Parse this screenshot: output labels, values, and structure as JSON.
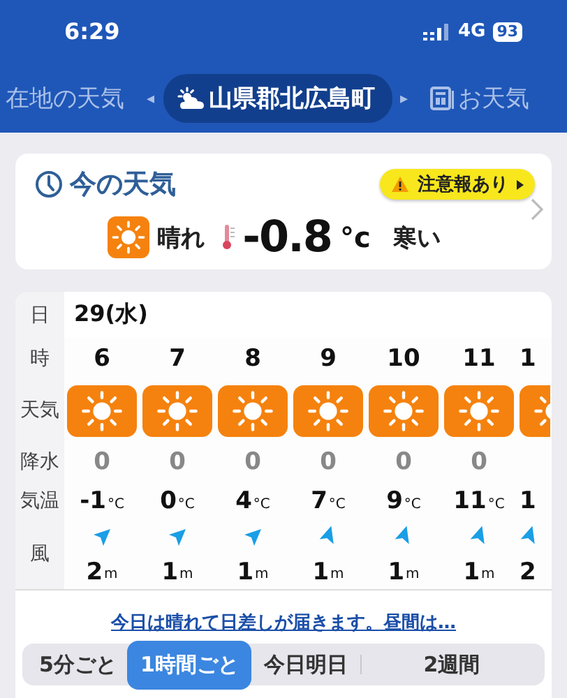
{
  "status_bar": {
    "time": "6:29",
    "network": "4G",
    "battery": "93"
  },
  "location_tabs": [
    {
      "label": "在地の天気",
      "selected": false,
      "kind": "plain"
    },
    {
      "label": "山県郡北広島町",
      "selected": true,
      "kind": "weather"
    },
    {
      "label": "お天気",
      "selected": false,
      "kind": "news"
    }
  ],
  "prev_arrow": "◂",
  "next_arrow": "▸",
  "now": {
    "title": "今の天気",
    "alert": "注意報あり",
    "condition": "晴れ",
    "temperature": "-0.8",
    "unit": "°c",
    "feel": "寒い"
  },
  "hourly": {
    "labels": [
      "日",
      "時",
      "天気",
      "降水",
      "気温",
      "風"
    ],
    "date": "29(水)",
    "columns": [
      {
        "hour": "6",
        "precip": "0",
        "temp": "-1",
        "temp_unit": "°C",
        "kind": "sw",
        "wind": "2",
        "wind_unit": "m"
      },
      {
        "hour": "7",
        "precip": "0",
        "temp": "0",
        "temp_unit": "°C",
        "kind": "sw",
        "wind": "1",
        "wind_unit": "m"
      },
      {
        "hour": "8",
        "precip": "0",
        "temp": "4",
        "temp_unit": "°C",
        "kind": "sw",
        "wind": "1",
        "wind_unit": "m"
      },
      {
        "hour": "9",
        "precip": "0",
        "temp": "7",
        "temp_unit": "°C",
        "kind": "wsw",
        "wind": "1",
        "wind_unit": "m"
      },
      {
        "hour": "10",
        "precip": "0",
        "temp": "9",
        "temp_unit": "°C",
        "kind": "wsw",
        "wind": "1",
        "wind_unit": "m"
      },
      {
        "hour": "11",
        "precip": "0",
        "temp": "11",
        "temp_unit": "°C",
        "kind": "wsw",
        "wind": "1",
        "wind_unit": "m"
      },
      {
        "hour": "1",
        "temp": "1",
        "kind": "wsw",
        "wind": "2"
      }
    ]
  },
  "summary_link": "今日は晴れて日差しが届きます。昼間は…",
  "view_tabs": [
    {
      "label": "5分ごと",
      "selected": false
    },
    {
      "label": "1時間ごと",
      "selected": true
    },
    {
      "label": "今日明日",
      "selected": false
    },
    {
      "label": "2週間",
      "selected": false
    }
  ]
}
